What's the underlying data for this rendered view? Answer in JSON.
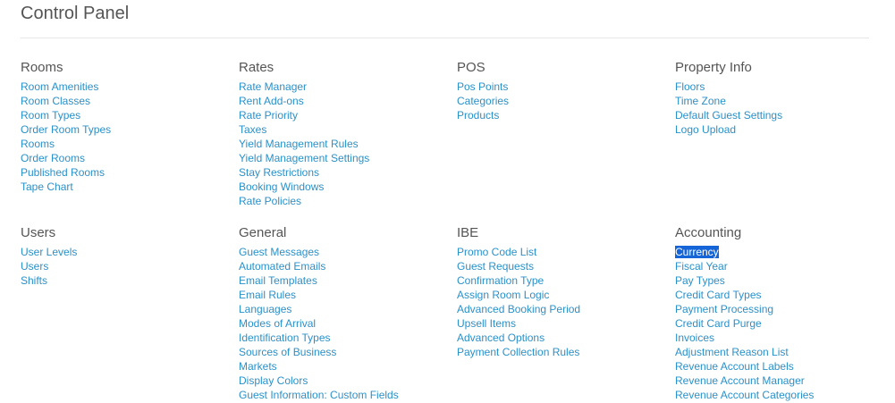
{
  "page": {
    "title": "Control Panel"
  },
  "colors": {
    "link": "#2a91c9",
    "heading": "#555555",
    "selection_bg": "#1565d8"
  },
  "sections": [
    {
      "heading": "Rooms",
      "links": [
        "Room Amenities",
        "Room Classes",
        "Room Types",
        "Order Room Types",
        "Rooms",
        "Order Rooms",
        "Published Rooms",
        "Tape Chart"
      ]
    },
    {
      "heading": "Rates",
      "links": [
        "Rate Manager",
        "Rent Add-ons",
        "Rate Priority",
        "Taxes",
        "Yield Management Rules",
        "Yield Management Settings",
        "Stay Restrictions",
        "Booking Windows",
        "Rate Policies"
      ]
    },
    {
      "heading": "POS",
      "links": [
        "Pos Points",
        "Categories",
        "Products"
      ]
    },
    {
      "heading": "Property Info",
      "links": [
        "Floors",
        "Time Zone",
        "Default Guest Settings",
        "Logo Upload"
      ]
    },
    {
      "heading": "Users",
      "links": [
        "User Levels",
        "Users",
        "Shifts"
      ]
    },
    {
      "heading": "General",
      "links": [
        "Guest Messages",
        "Automated Emails",
        "Email Templates",
        "Email Rules",
        "Languages",
        "Modes of Arrival",
        "Identification Types",
        "Sources of Business",
        "Markets",
        "Display Colors",
        "Guest Information: Custom Fields"
      ]
    },
    {
      "heading": "IBE",
      "links": [
        "Promo Code List",
        "Guest Requests",
        "Confirmation Type",
        "Assign Room Logic",
        "Advanced Booking Period",
        "Upsell Items",
        "Advanced Options",
        "Payment Collection Rules"
      ]
    },
    {
      "heading": "Accounting",
      "selected_link": "Currency",
      "links": [
        "Currency",
        "Fiscal Year",
        "Pay Types",
        "Credit Card Types",
        "Payment Processing",
        "Credit Card Purge",
        "Invoices",
        "Adjustment Reason List",
        "Revenue Account Labels",
        "Revenue Account Manager",
        "Revenue Account Categories"
      ]
    }
  ]
}
